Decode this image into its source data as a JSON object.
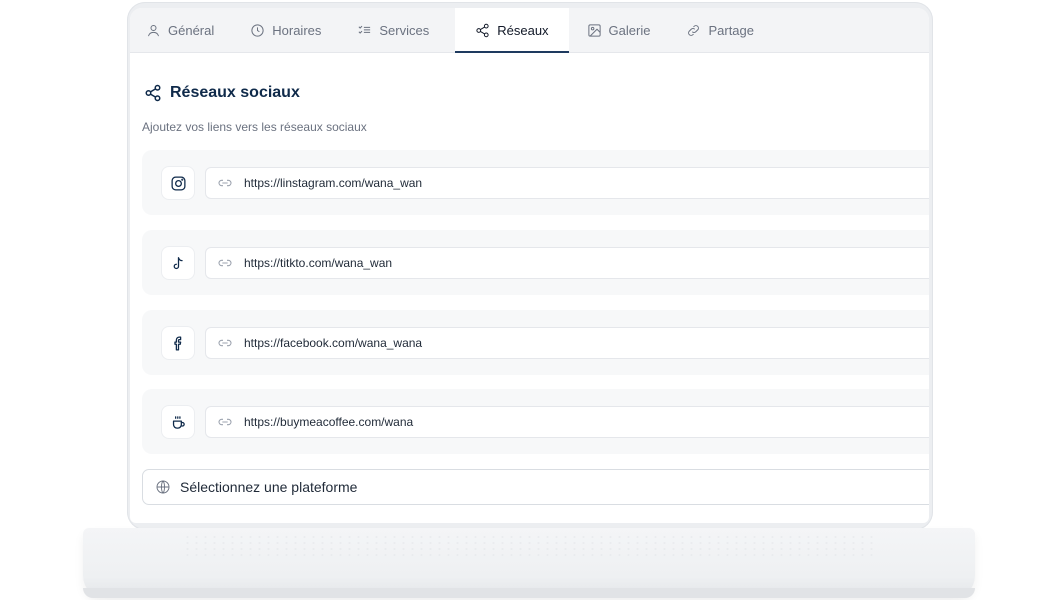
{
  "tabs": [
    {
      "label": "Général",
      "icon": "user-icon"
    },
    {
      "label": "Horaires",
      "icon": "clock-icon"
    },
    {
      "label": "Services",
      "icon": "list-check-icon"
    },
    {
      "label": "Réseaux",
      "icon": "share-icon",
      "active": true
    },
    {
      "label": "Galerie",
      "icon": "image-icon"
    },
    {
      "label": "Partage",
      "icon": "link-icon"
    }
  ],
  "section": {
    "title": "Réseaux sociaux",
    "subtitle": "Ajoutez vos liens vers les réseaux sociaux"
  },
  "social_links": [
    {
      "platform_icon": "instagram-icon",
      "url": "https://linstagram.com/wana_wan"
    },
    {
      "platform_icon": "tiktok-icon",
      "url": "https://titkto.com/wana_wan"
    },
    {
      "platform_icon": "facebook-icon",
      "url": "https://facebook.com/wana_wana"
    },
    {
      "platform_icon": "coffee-icon",
      "url": "https://buymeacoffee.com/wana"
    }
  ],
  "platform_select": {
    "placeholder": "Sélectionnez une plateforme",
    "icon": "globe-icon"
  },
  "colors": {
    "accent": "#1e3a5f",
    "title": "#0f2a4a",
    "muted": "#6b7280"
  }
}
